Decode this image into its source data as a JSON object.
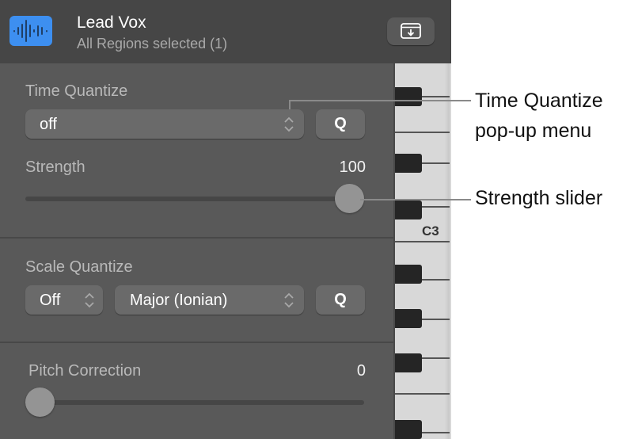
{
  "header": {
    "track_icon": "audio-waveform-icon",
    "track_icon_color": "#3d8ff0",
    "track_name": "Lead Vox",
    "subtitle": "All Regions selected (1)",
    "action_button_icon": "download-window-icon"
  },
  "time_quantize": {
    "label": "Time Quantize",
    "value": "off",
    "q_label": "Q"
  },
  "strength": {
    "label": "Strength",
    "value": "100",
    "fraction": 1.0
  },
  "scale_quantize": {
    "label": "Scale Quantize",
    "mode_value": "Off",
    "scale_value": "Major (Ionian)",
    "q_label": "Q"
  },
  "pitch_correction": {
    "label": "Pitch Correction",
    "value": "0",
    "fraction": 0.0
  },
  "keyboard": {
    "note_label": "C3"
  },
  "callouts": {
    "time_quantize_line1": "Time Quantize",
    "time_quantize_line2": "pop-up menu",
    "strength": "Strength slider"
  }
}
